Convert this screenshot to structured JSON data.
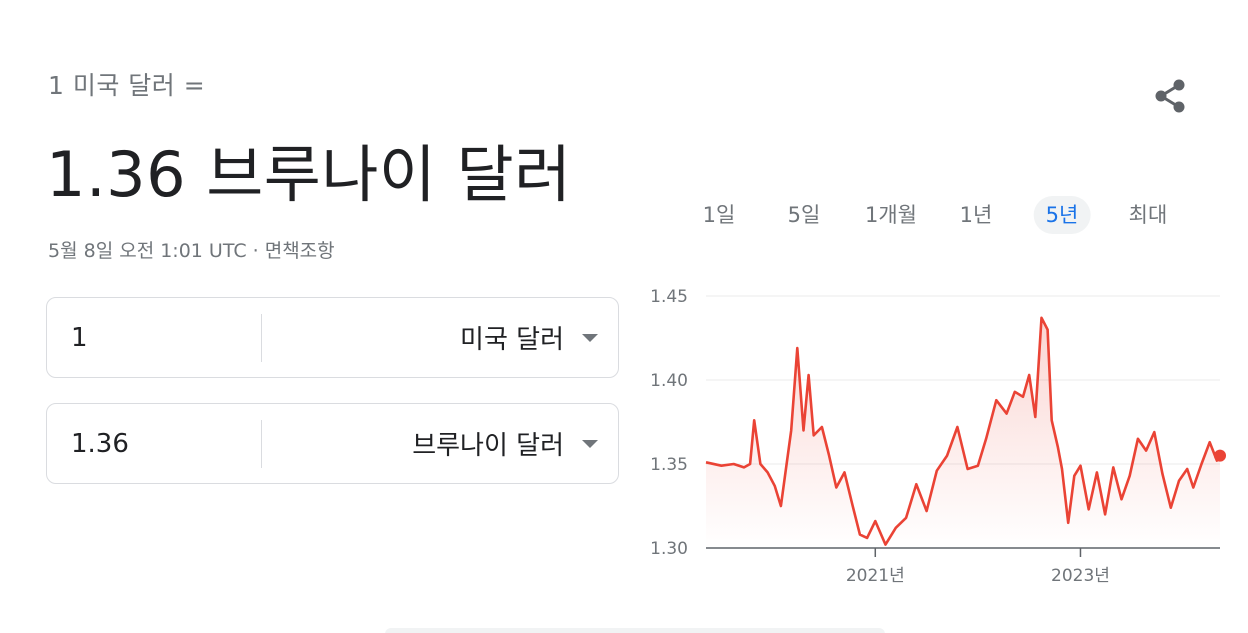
{
  "header": {
    "subtitle": "1 미국 달러 =",
    "result": "1.36 브루나이 달러",
    "updated": "5월 8일 오전 1:01 UTC · ",
    "disclaimer": "면책조항"
  },
  "share": {
    "icon": "share-icon"
  },
  "converter": {
    "from": {
      "value": "1",
      "currency": "미국 달러"
    },
    "to": {
      "value": "1.36",
      "currency": "브루나이 달러"
    }
  },
  "tabs": [
    {
      "label": "1일",
      "active": false
    },
    {
      "label": "5일",
      "active": false
    },
    {
      "label": "1개월",
      "active": false
    },
    {
      "label": "1년",
      "active": false
    },
    {
      "label": "5년",
      "active": true
    },
    {
      "label": "최대",
      "active": false
    }
  ],
  "colors": {
    "line": "#ea4335",
    "accent": "#1a73e8",
    "muted": "#70757a"
  },
  "chart_data": {
    "type": "line",
    "series": [
      {
        "x": [
          2019.35,
          2019.5,
          2019.62,
          2019.72,
          2019.78,
          2019.82,
          2019.88,
          2019.95,
          2020.02,
          2020.08,
          2020.12,
          2020.18,
          2020.24,
          2020.3,
          2020.35,
          2020.4,
          2020.48,
          2020.55,
          2020.62,
          2020.7,
          2020.78,
          2020.85,
          2020.92,
          2021.0,
          2021.1,
          2021.2,
          2021.3,
          2021.4,
          2021.5,
          2021.6,
          2021.7,
          2021.8,
          2021.9,
          2022.0,
          2022.08,
          2022.18,
          2022.28,
          2022.36,
          2022.44,
          2022.5,
          2022.56,
          2022.62,
          2022.68,
          2022.72,
          2022.78,
          2022.82,
          2022.88,
          2022.94,
          2023.0,
          2023.08,
          2023.16,
          2023.24,
          2023.32,
          2023.4,
          2023.48,
          2023.56,
          2023.64,
          2023.72,
          2023.8,
          2023.88,
          2023.96,
          2024.04,
          2024.1,
          2024.18,
          2024.26,
          2024.33,
          2024.36
        ],
        "y": [
          1.351,
          1.349,
          1.35,
          1.348,
          1.35,
          1.376,
          1.35,
          1.345,
          1.337,
          1.325,
          1.343,
          1.37,
          1.419,
          1.37,
          1.403,
          1.367,
          1.372,
          1.355,
          1.336,
          1.345,
          1.325,
          1.308,
          1.306,
          1.316,
          1.302,
          1.312,
          1.318,
          1.338,
          1.322,
          1.346,
          1.355,
          1.372,
          1.347,
          1.349,
          1.365,
          1.388,
          1.38,
          1.393,
          1.39,
          1.403,
          1.378,
          1.437,
          1.43,
          1.376,
          1.36,
          1.347,
          1.315,
          1.343,
          1.349,
          1.323,
          1.345,
          1.32,
          1.348,
          1.329,
          1.343,
          1.365,
          1.358,
          1.369,
          1.344,
          1.324,
          1.34,
          1.347,
          1.336,
          1.35,
          1.363,
          1.352,
          1.355
        ]
      }
    ],
    "xticks": [
      "2021년",
      "2023년"
    ],
    "yticks": [
      "1.30",
      "1.35",
      "1.40",
      "1.45"
    ],
    "xlim": [
      2019.35,
      2024.36
    ],
    "ylim": [
      1.3,
      1.45
    ],
    "grid": true
  }
}
